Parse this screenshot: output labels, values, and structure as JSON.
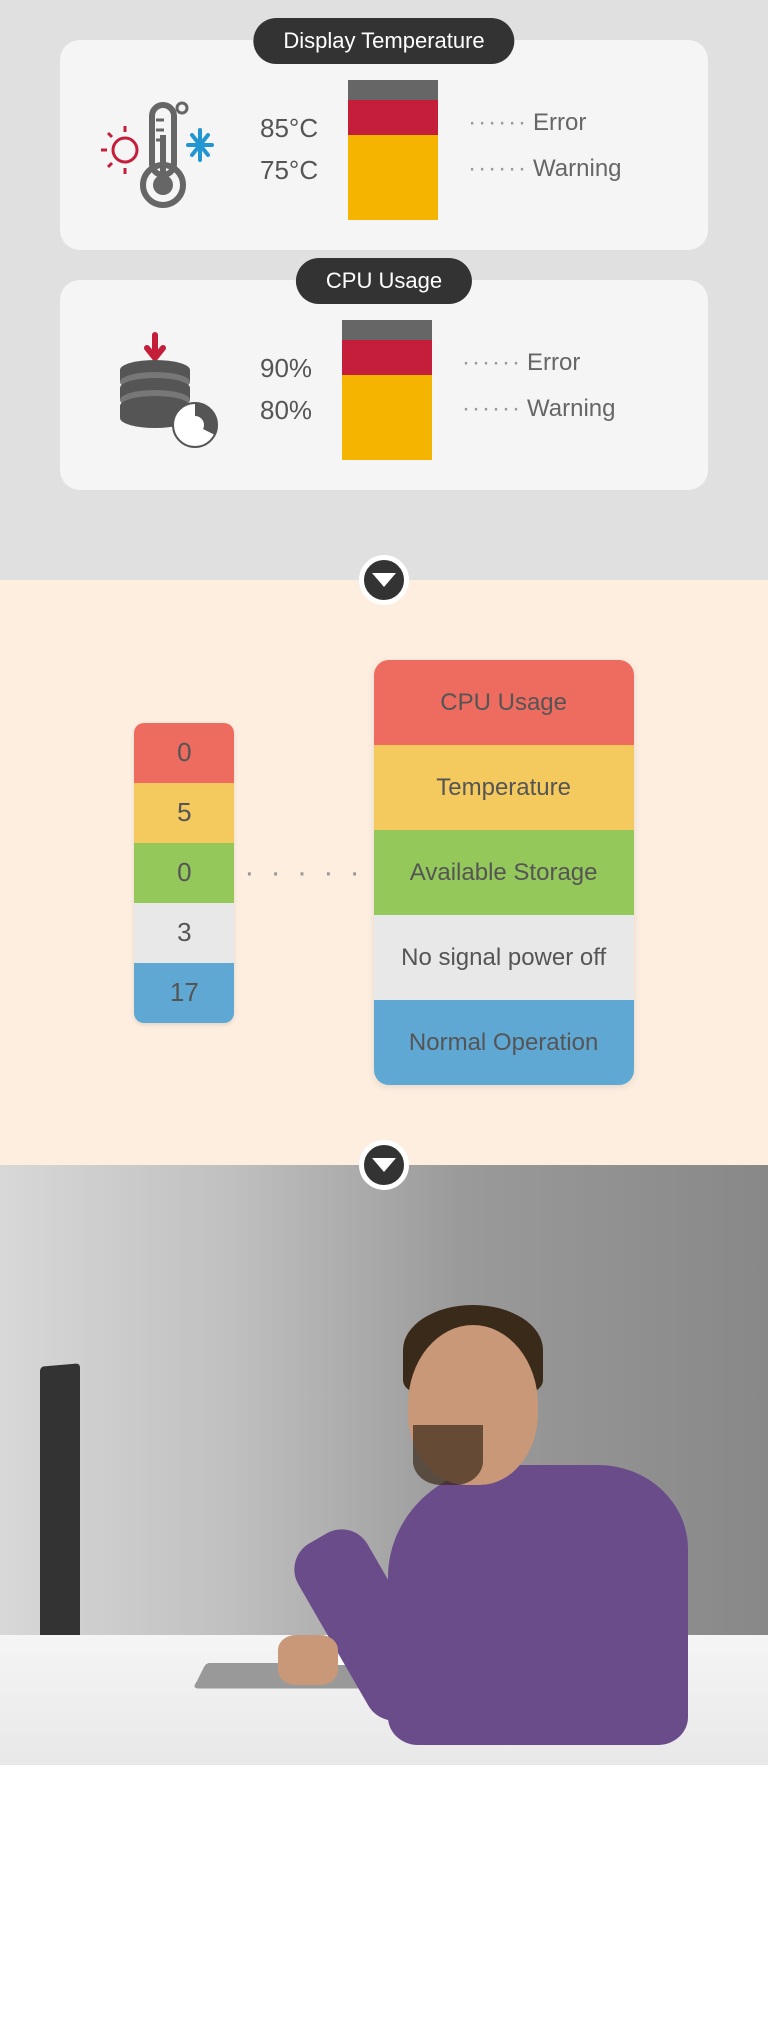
{
  "section1": {
    "card1": {
      "title": "Display Temperature",
      "val1": "85°C",
      "val2": "75°C",
      "label1": "Error",
      "label2": "Warning"
    },
    "card2": {
      "title": "CPU Usage",
      "val1": "90%",
      "val2": "80%",
      "label1": "Error",
      "label2": "Warning"
    }
  },
  "section2": {
    "mini": [
      "0",
      "5",
      "0",
      "3",
      "17"
    ],
    "dots": "· · · · ·",
    "big": [
      "CPU Usage",
      "Temperature",
      "Available Storage",
      "No signal power off",
      "Normal Operation"
    ]
  },
  "dotline": "······"
}
